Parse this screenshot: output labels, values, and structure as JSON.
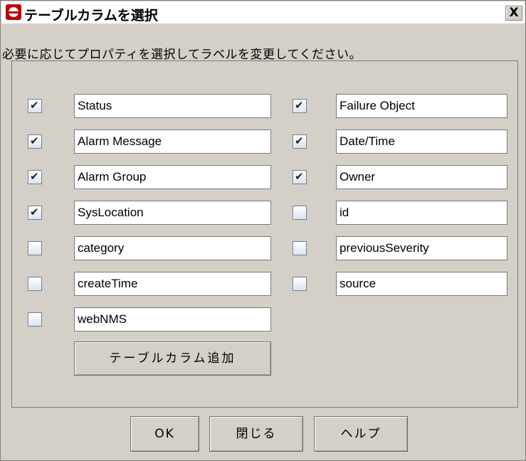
{
  "window": {
    "title": "テーブルカラムを選択",
    "close_label": "X",
    "icon": "app-logo-icon"
  },
  "instruction": "必要に応じてプロパティを選択してラベルを変更してください。",
  "columns": {
    "left": [
      {
        "label": "Status",
        "checked": true
      },
      {
        "label": "Alarm Message",
        "checked": true
      },
      {
        "label": "Alarm Group",
        "checked": true
      },
      {
        "label": "SysLocation",
        "checked": true
      },
      {
        "label": "category",
        "checked": false
      },
      {
        "label": "createTime",
        "checked": false
      },
      {
        "label": "webNMS",
        "checked": false
      }
    ],
    "right": [
      {
        "label": "Failure Object",
        "checked": true
      },
      {
        "label": "Date/Time",
        "checked": true
      },
      {
        "label": "Owner",
        "checked": true
      },
      {
        "label": "id",
        "checked": false
      },
      {
        "label": "previousSeverity",
        "checked": false
      },
      {
        "label": "source",
        "checked": false
      }
    ]
  },
  "add_column_label": "テーブルカラム追加",
  "footer": {
    "ok_label": "OK",
    "close_label": "閉じる",
    "help_label": "ヘルプ"
  },
  "colors": {
    "dialog_bg": "#d4d0c8",
    "field_bg": "#ffffff",
    "icon_red": "#c00000"
  }
}
